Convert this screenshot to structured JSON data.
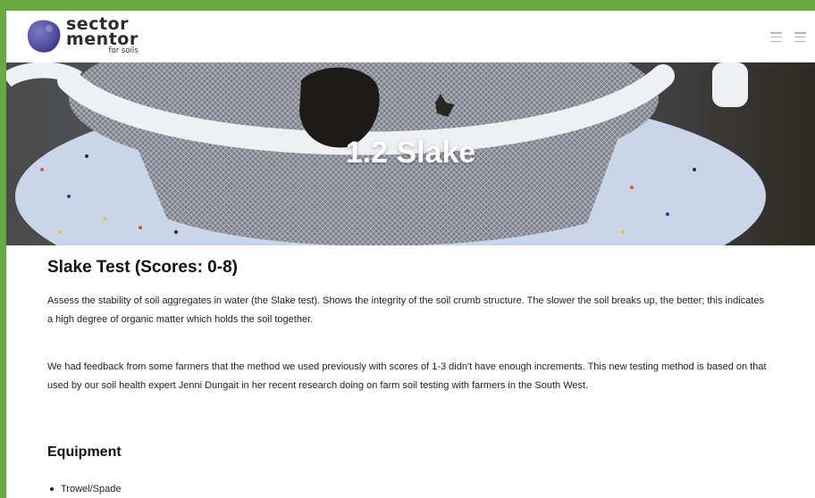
{
  "brand": {
    "line1": "sector",
    "line2": "mentor",
    "line3": "for soils",
    "logo_color": "#5b55a8"
  },
  "header": {
    "icons": [
      "menu-icon",
      "menu-icon"
    ]
  },
  "hero": {
    "title": "1.2 Slake"
  },
  "content": {
    "heading": "Slake Test (Scores: 0-8)",
    "paragraph1": "Assess the stability of soil aggregates in water (the Slake test). Shows the integrity of the soil crumb structure. The slower the soil breaks up, the better; this indicates a high degree of organic matter which holds the soil together.",
    "paragraph2": "We had feedback from some farmers that the method we used previously with scores of 1-3 didn't have enough increments. This new testing method is based on that used by our soil health expert Jenni Dungait in her recent research doing on farm soil testing with farmers in the South West.",
    "equipment_heading": "Equipment",
    "equipment_items": [
      "Trowel/Spade"
    ]
  },
  "colors": {
    "page_border": "#6aa842",
    "text": "#222222"
  }
}
